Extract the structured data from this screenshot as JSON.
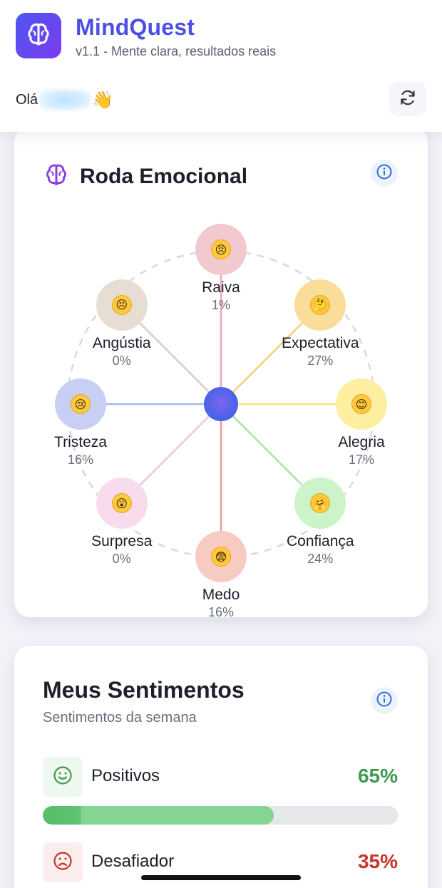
{
  "header": {
    "title": "MindQuest",
    "subtitle": "v1.1 - Mente clara, resultados reais",
    "greeting_prefix": "Olá",
    "greeting_emoji": "👋",
    "logo_icon": "brain-icon",
    "refresh_icon": "refresh-icon"
  },
  "wheel": {
    "title": "Roda Emocional",
    "title_icon": "brain-outline-icon",
    "emotions": [
      {
        "key": "raiva",
        "label": "Raiva",
        "pct": "1%",
        "emoji": "😠",
        "color": "#f2c9cf",
        "line": "#f0a7b3"
      },
      {
        "key": "expectativa",
        "label": "Expectativa",
        "pct": "27%",
        "emoji": "🤔",
        "color": "#fbdd9a",
        "line": "#f7cf78"
      },
      {
        "key": "alegria",
        "label": "Alegria",
        "pct": "17%",
        "emoji": "😊",
        "color": "#fdeea0",
        "line": "#f8e27a"
      },
      {
        "key": "confianca",
        "label": "Confiança",
        "pct": "24%",
        "emoji": "🤗",
        "color": "#cdf3c8",
        "line": "#a9e6a2"
      },
      {
        "key": "medo",
        "label": "Medo",
        "pct": "16%",
        "emoji": "😨",
        "color": "#f7cbc2",
        "line": "#ef9e96"
      },
      {
        "key": "surpresa",
        "label": "Surpresa",
        "pct": "0%",
        "emoji": "😲",
        "color": "#f9dbee",
        "line": "#f5c2dc"
      },
      {
        "key": "tristeza",
        "label": "Tristeza",
        "pct": "16%",
        "emoji": "😢",
        "color": "#c7cff5",
        "line": "#a9b7ef"
      },
      {
        "key": "angustia",
        "label": "Angústia",
        "pct": "0%",
        "emoji": "😣",
        "color": "#e8ddd3",
        "line": "#dccdbd"
      }
    ]
  },
  "feelings": {
    "title": "Meus Sentimentos",
    "subtitle": "Sentimentos da semana",
    "positive": {
      "label": "Positivos",
      "pct": "65%",
      "value": 0.65,
      "color": "#3f9a4f"
    },
    "challenging": {
      "label": "Desafiador",
      "pct": "35%",
      "value": 0.35,
      "color": "#c8342c"
    }
  },
  "colors": {
    "brand": "#4b4fe6",
    "accent_info": "#2f6fd8"
  }
}
